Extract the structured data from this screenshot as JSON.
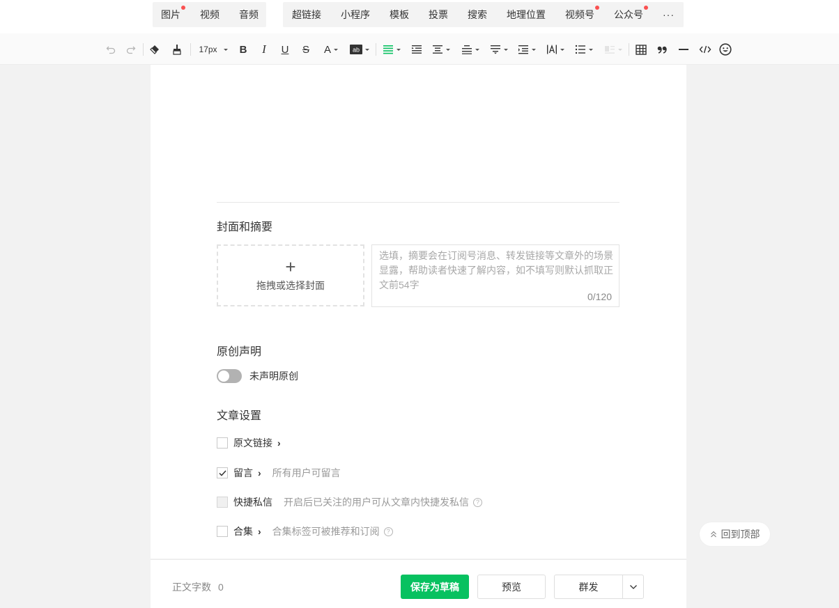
{
  "insert_bar": {
    "group1": [
      {
        "label": "图片",
        "dot": true
      },
      {
        "label": "视频",
        "dot": false
      },
      {
        "label": "音频",
        "dot": false
      }
    ],
    "group2": [
      {
        "label": "超链接",
        "dot": false
      },
      {
        "label": "小程序",
        "dot": false
      },
      {
        "label": "模板",
        "dot": false
      },
      {
        "label": "投票",
        "dot": false
      },
      {
        "label": "搜索",
        "dot": false
      },
      {
        "label": "地理位置",
        "dot": false
      },
      {
        "label": "视频号",
        "dot": true
      },
      {
        "label": "公众号",
        "dot": true
      }
    ],
    "more": "···"
  },
  "toolbar": {
    "font_size": "17px",
    "bold": "B",
    "italic": "I",
    "underline": "U",
    "strike": "S",
    "font_color": "A",
    "accent_color": "#07c160"
  },
  "cover": {
    "title": "封面和摘要",
    "plus": "+",
    "label": "拖拽或选择封面",
    "summary_placeholder": "选填，摘要会在订阅号消息、转发链接等文章外的场景显露，帮助读者快速了解内容，如不填写则默认抓取正文前54字",
    "summary_count": "0/120"
  },
  "original": {
    "title": "原创声明",
    "toggle_on": false,
    "toggle_label": "未声明原创"
  },
  "settings": {
    "title": "文章设置",
    "items": [
      {
        "label": "原文链接",
        "checked": false,
        "disabled": false,
        "chevron": "›",
        "desc": "",
        "help": false
      },
      {
        "label": "留言",
        "checked": true,
        "disabled": false,
        "chevron": "›",
        "desc": "所有用户可留言",
        "help": false
      },
      {
        "label": "快捷私信",
        "checked": false,
        "disabled": true,
        "chevron": "",
        "desc": "开启后已关注的用户可从文章内快捷发私信",
        "help": true
      },
      {
        "label": "合集",
        "checked": false,
        "disabled": false,
        "chevron": "›",
        "desc": "合集标签可被推荐和订阅",
        "help": true
      }
    ]
  },
  "bottom": {
    "wordcount_label": "正文字数",
    "wordcount_value": "0",
    "save_draft": "保存为草稿",
    "preview": "预览",
    "publish": "群发"
  },
  "back_to_top": "回到顶部",
  "help_glyph": "?"
}
